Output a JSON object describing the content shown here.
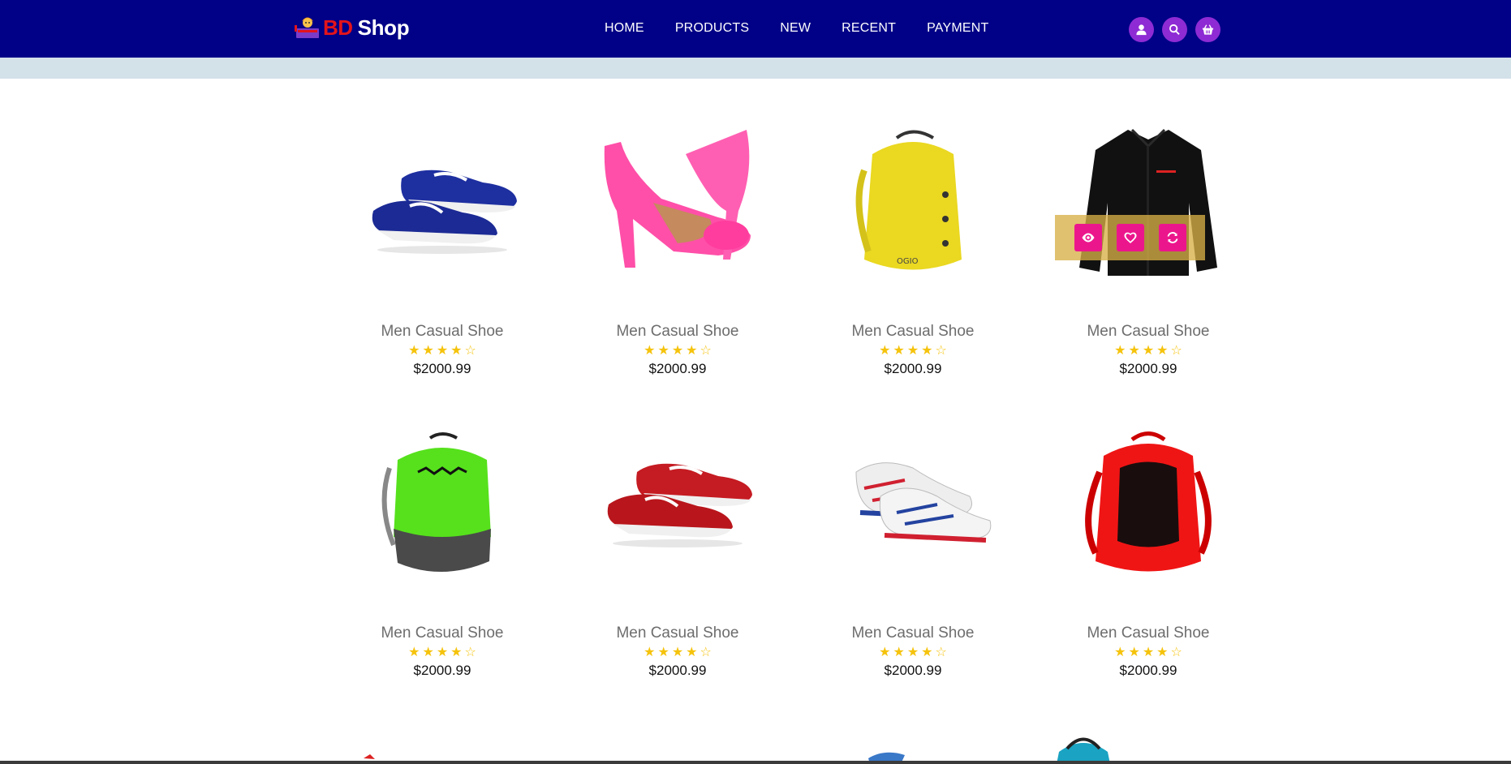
{
  "brand": {
    "bd": "BD",
    "shop": "Shop",
    "logo_icon": "shopkeeper-logo-icon",
    "bd_color": "#e3141b"
  },
  "nav": {
    "background": "#010187",
    "items": [
      {
        "label": "HOME"
      },
      {
        "label": "PRODUCTS"
      },
      {
        "label": "NEW"
      },
      {
        "label": "RECENT"
      },
      {
        "label": "PAYMENT"
      }
    ],
    "icons": [
      "user-icon",
      "search-icon",
      "basket-icon"
    ],
    "icon_color": "#8e2bd4"
  },
  "products": [
    {
      "title": "Men Casual Shoe",
      "price": "$2000.99",
      "rating": 4,
      "max_rating": 5,
      "image": "blue-boat-shoes"
    },
    {
      "title": "Men Casual Shoe",
      "price": "$2000.99",
      "rating": 4,
      "max_rating": 5,
      "image": "pink-high-heel"
    },
    {
      "title": "Men Casual Shoe",
      "price": "$2000.99",
      "rating": 4,
      "max_rating": 5,
      "image": "yellow-backpack"
    },
    {
      "title": "Men Casual Shoe",
      "price": "$2000.99",
      "rating": 4,
      "max_rating": 5,
      "image": "black-shirt",
      "hover_actions": [
        "eye-icon",
        "heart-icon",
        "refresh-icon"
      ]
    },
    {
      "title": "Men Casual Shoe",
      "price": "$2000.99",
      "rating": 4,
      "max_rating": 5,
      "image": "green-backpack"
    },
    {
      "title": "Men Casual Shoe",
      "price": "$2000.99",
      "rating": 4,
      "max_rating": 5,
      "image": "red-boat-shoes"
    },
    {
      "title": "Men Casual Shoe",
      "price": "$2000.99",
      "rating": 4,
      "max_rating": 5,
      "image": "white-sneakers"
    },
    {
      "title": "Men Casual Shoe",
      "price": "$2000.99",
      "rating": 4,
      "max_rating": 5,
      "image": "red-backpack"
    }
  ],
  "colors": {
    "star": "#f5c30c",
    "action_button": "#ec168c",
    "overlay": "#d7b046"
  }
}
